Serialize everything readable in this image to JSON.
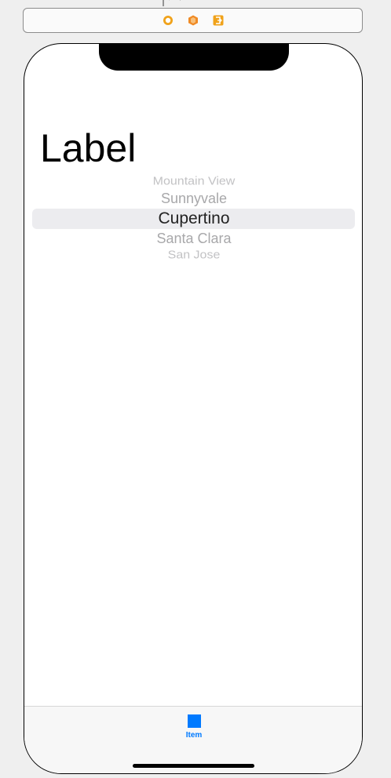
{
  "scene": {
    "icons": [
      "view-controller-icon",
      "first-responder-icon",
      "exit-icon"
    ],
    "colors": {
      "view_controller": "#f0a21a",
      "first_responder": "#f08a24",
      "exit": "#f0a21a"
    }
  },
  "content": {
    "label_text": "Label"
  },
  "picker": {
    "items": [
      "Mountain View",
      "Sunnyvale",
      "Cupertino",
      "Santa Clara",
      "San Jose"
    ],
    "selected_index": 2
  },
  "tabbar": {
    "items": [
      {
        "label": "Item",
        "icon": "square-icon",
        "color": "#007aff"
      }
    ]
  }
}
